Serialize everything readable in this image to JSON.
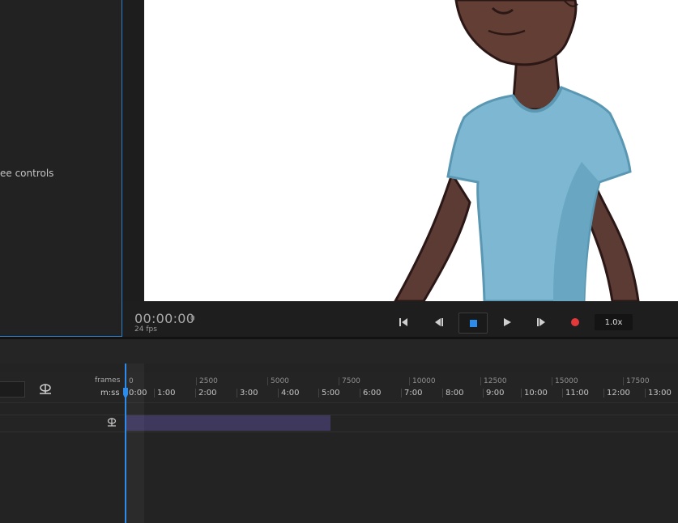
{
  "left_panel": {
    "label": "ee controls"
  },
  "transport": {
    "timecode": "00:00:00",
    "frame": "0",
    "fps": "24 fps",
    "speed": "1.0x",
    "record_color": "#e5383b",
    "accent_color": "#2d8ceb"
  },
  "ruler": {
    "frames_label": "frames",
    "time_label": "m:ss",
    "frame_ticks": [
      "0",
      "2500",
      "5000",
      "7500",
      "10000",
      "12500",
      "15000",
      "17500"
    ],
    "time_ticks": [
      "0:00",
      "1:00",
      "2:00",
      "3:00",
      "4:00",
      "5:00",
      "6:00",
      "7:00",
      "8:00",
      "9:00",
      "10:00",
      "11:00",
      "12:00",
      "13:00"
    ]
  },
  "track": {
    "clip_color": "#3d385c"
  },
  "icons": [
    "puppet-icon",
    "skip-start-icon",
    "step-back-icon",
    "stop-icon",
    "play-icon",
    "step-forward-icon",
    "record-icon"
  ]
}
